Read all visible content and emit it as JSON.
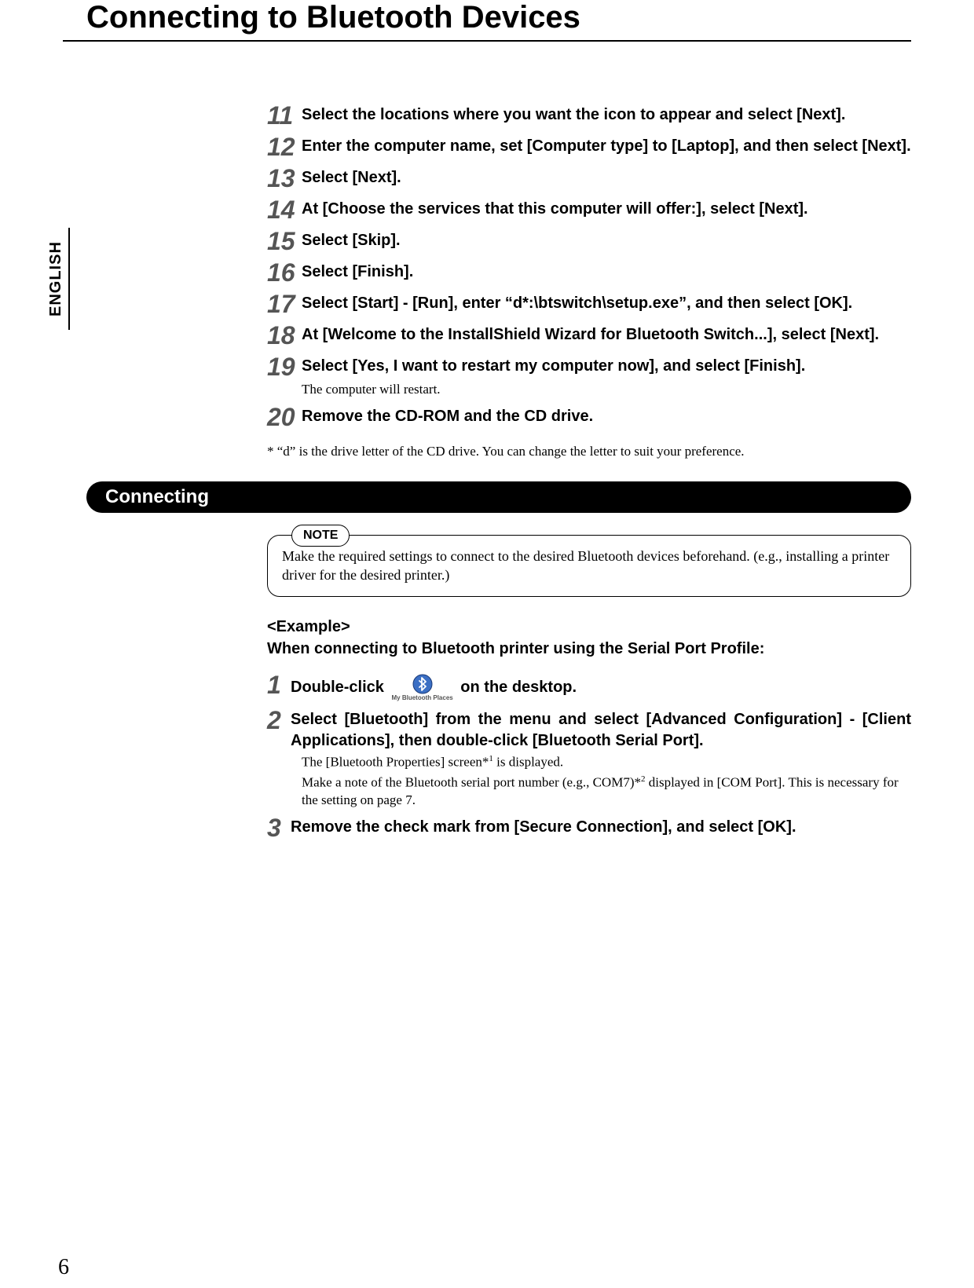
{
  "title": "Connecting to Bluetooth Devices",
  "language_tab": "ENGLISH",
  "steps_a": [
    {
      "num": "11",
      "text": "Select the locations where you want the icon to appear and select [Next]."
    },
    {
      "num": "12",
      "text": "Enter the computer name, set [Computer type] to [Laptop], and then select [Next]."
    },
    {
      "num": "13",
      "text": "Select [Next]."
    },
    {
      "num": "14",
      "text": "At [Choose the services that this computer will offer:], select [Next]."
    },
    {
      "num": "15",
      "text": "Select [Skip]."
    },
    {
      "num": "16",
      "text": "Select [Finish]."
    },
    {
      "num": "17",
      "text": "Select [Start] - [Run], enter “d*:\\btswitch\\setup.exe”, and then select [OK]."
    },
    {
      "num": "18",
      "text": "At [Welcome to the InstallShield Wizard for Bluetooth Switch...], select [Next]."
    },
    {
      "num": "19",
      "text": "Select [Yes, I want to restart my computer now], and select [Finish].",
      "sub": "The computer will restart."
    },
    {
      "num": "20",
      "text": "Remove the CD-ROM and the CD drive."
    }
  ],
  "footnote": "*  “d” is the drive letter of the CD drive. You can change the letter to suit your preference.",
  "section_heading": "Connecting",
  "note_label": "NOTE",
  "note_body": "Make the required settings to connect to the desired Bluetooth devices beforehand. (e.g., installing a printer driver for the desired printer.)",
  "example_label": "<Example>",
  "example_title": "When connecting to Bluetooth printer using the Serial Port Profile:",
  "steps_b": {
    "s1": {
      "num": "1",
      "pre": "Double-click ",
      "post": " on the desktop.",
      "icon_label": "My Bluetooth Places"
    },
    "s2": {
      "num": "2",
      "text": "Select [Bluetooth] from the menu and select [Advanced Configuration] - [Client Applications], then double-click [Bluetooth Serial Port].",
      "sub1_a": "The [Bluetooth Properties] screen*",
      "sub1_b": " is displayed.",
      "sub2_a": "Make a note of the Bluetooth serial port number (e.g., COM7)*",
      "sub2_b": " displayed in [COM Port]. This is necessary for the setting on page 7."
    },
    "s3": {
      "num": "3",
      "text": "Remove the check mark from [Secure Connection], and select [OK]."
    }
  },
  "page_number": "6"
}
